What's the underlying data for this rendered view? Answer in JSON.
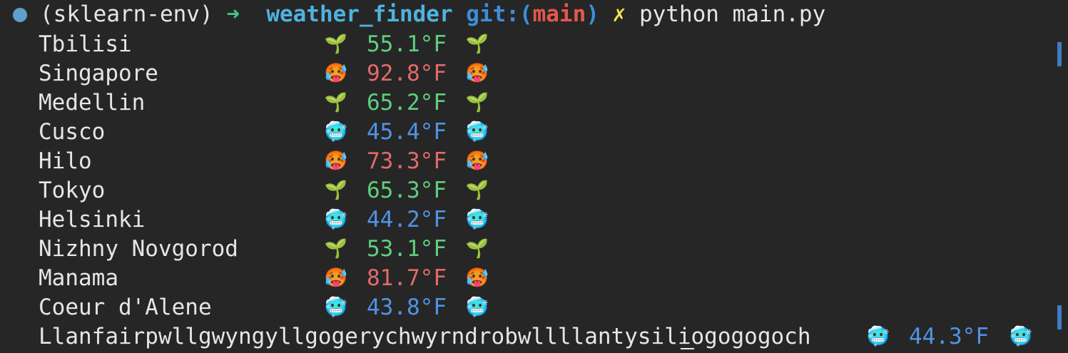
{
  "prompt": {
    "env": "(sklearn-env)",
    "arrow": "➜",
    "directory": "weather_finder",
    "git_label_open": "git:(",
    "branch": "main",
    "git_label_close": ")",
    "dirty_marker": "✗",
    "command": "python main.py"
  },
  "rows": [
    {
      "city": "Tbilisi",
      "temp": "55.1°F",
      "emoji": "🌱",
      "emoji_name": "seedling-icon",
      "kind": "mild"
    },
    {
      "city": "Singapore",
      "temp": "92.8°F",
      "emoji": "🥵",
      "emoji_name": "hot-face-icon",
      "kind": "hot"
    },
    {
      "city": "Medellin",
      "temp": "65.2°F",
      "emoji": "🌱",
      "emoji_name": "seedling-icon",
      "kind": "mild"
    },
    {
      "city": "Cusco",
      "temp": "45.4°F",
      "emoji": "🥶",
      "emoji_name": "cold-face-icon",
      "kind": "cold"
    },
    {
      "city": "Hilo",
      "temp": "73.3°F",
      "emoji": "🥵",
      "emoji_name": "hot-face-icon",
      "kind": "hot"
    },
    {
      "city": "Tokyo",
      "temp": "65.3°F",
      "emoji": "🌱",
      "emoji_name": "seedling-icon",
      "kind": "mild"
    },
    {
      "city": "Helsinki",
      "temp": "44.2°F",
      "emoji": "🥶",
      "emoji_name": "cold-face-icon",
      "kind": "cold"
    },
    {
      "city": "Nizhny Novgorod",
      "temp": "53.1°F",
      "emoji": "🌱",
      "emoji_name": "seedling-icon",
      "kind": "mild"
    },
    {
      "city": "Manama",
      "temp": "81.7°F",
      "emoji": "🥵",
      "emoji_name": "hot-face-icon",
      "kind": "hot"
    },
    {
      "city": "Coeur d'Alene",
      "temp": "43.8°F",
      "emoji": "🥶",
      "emoji_name": "cold-face-icon",
      "kind": "cold"
    },
    {
      "city": "Llanfairpwllgwyngyllgogerychwyrndrobwllllantysiliogogogoch",
      "temp": "44.3°F",
      "emoji": "🥶",
      "emoji_name": "cold-face-icon",
      "kind": "cold"
    }
  ],
  "colors": {
    "background": "#262626",
    "text": "#e6e6e6",
    "mild": "#5fcf7d",
    "hot": "#e36a6a",
    "cold": "#4f94e6",
    "directory": "#4fb2df",
    "branch": "#e5574d",
    "dirty": "#f7e24d"
  }
}
